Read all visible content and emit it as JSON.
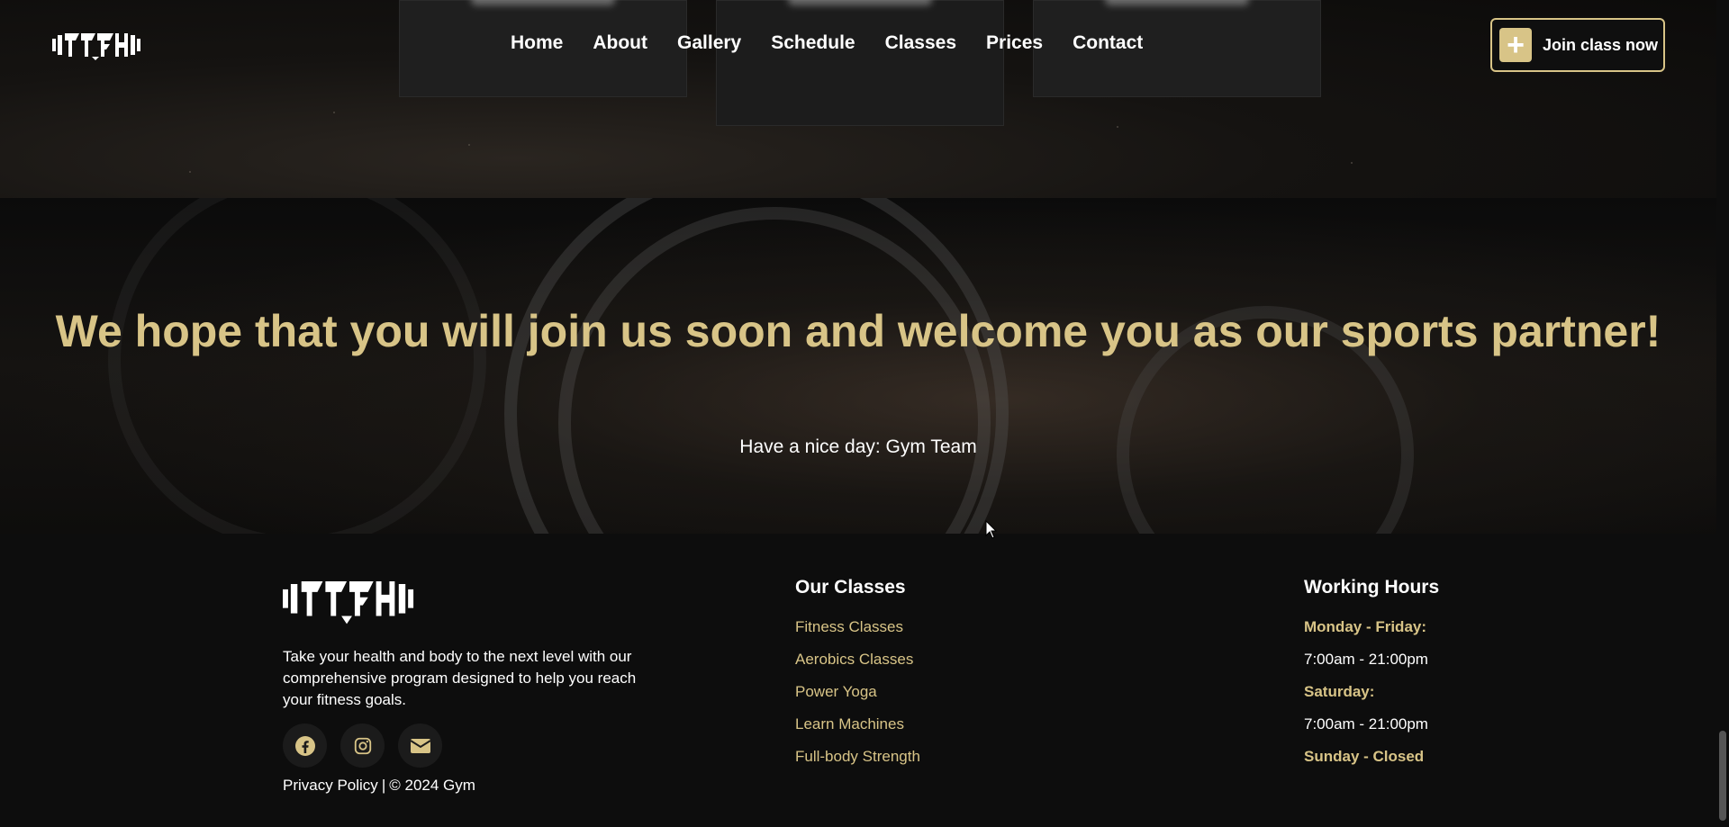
{
  "header": {
    "logo_alt": "ATF Gym logo",
    "nav": [
      "Home",
      "About",
      "Gallery",
      "Schedule",
      "Classes",
      "Prices",
      "Contact"
    ],
    "join_button": "Join class now"
  },
  "hero": {
    "title": "We hope that you will join us soon and welcome you as our sports partner!",
    "subtitle": "Have a nice day: Gym Team"
  },
  "footer": {
    "about_text": "Take your health and body to the next level with our comprehensive program designed to help you reach your fitness goals.",
    "social_icons": [
      "facebook-icon",
      "instagram-icon",
      "email-icon"
    ],
    "privacy_link": "Privacy Policy",
    "separator": "|",
    "copyright": "© 2024 Gym",
    "classes": {
      "heading": "Our Classes",
      "items": [
        "Fitness Classes",
        "Aerobics Classes",
        "Power Yoga",
        "Learn Machines",
        "Full-body Strength"
      ]
    },
    "hours": {
      "heading": "Working Hours",
      "weekday_label": "Monday - Friday:",
      "weekday_time": "7:00am - 21:00pm",
      "saturday_label": "Saturday:",
      "saturday_time": "7:00am - 21:00pm",
      "sunday_label": "Sunday - Closed"
    }
  },
  "colors": {
    "accent": "#d8c487",
    "background": "#0d0d0d"
  }
}
